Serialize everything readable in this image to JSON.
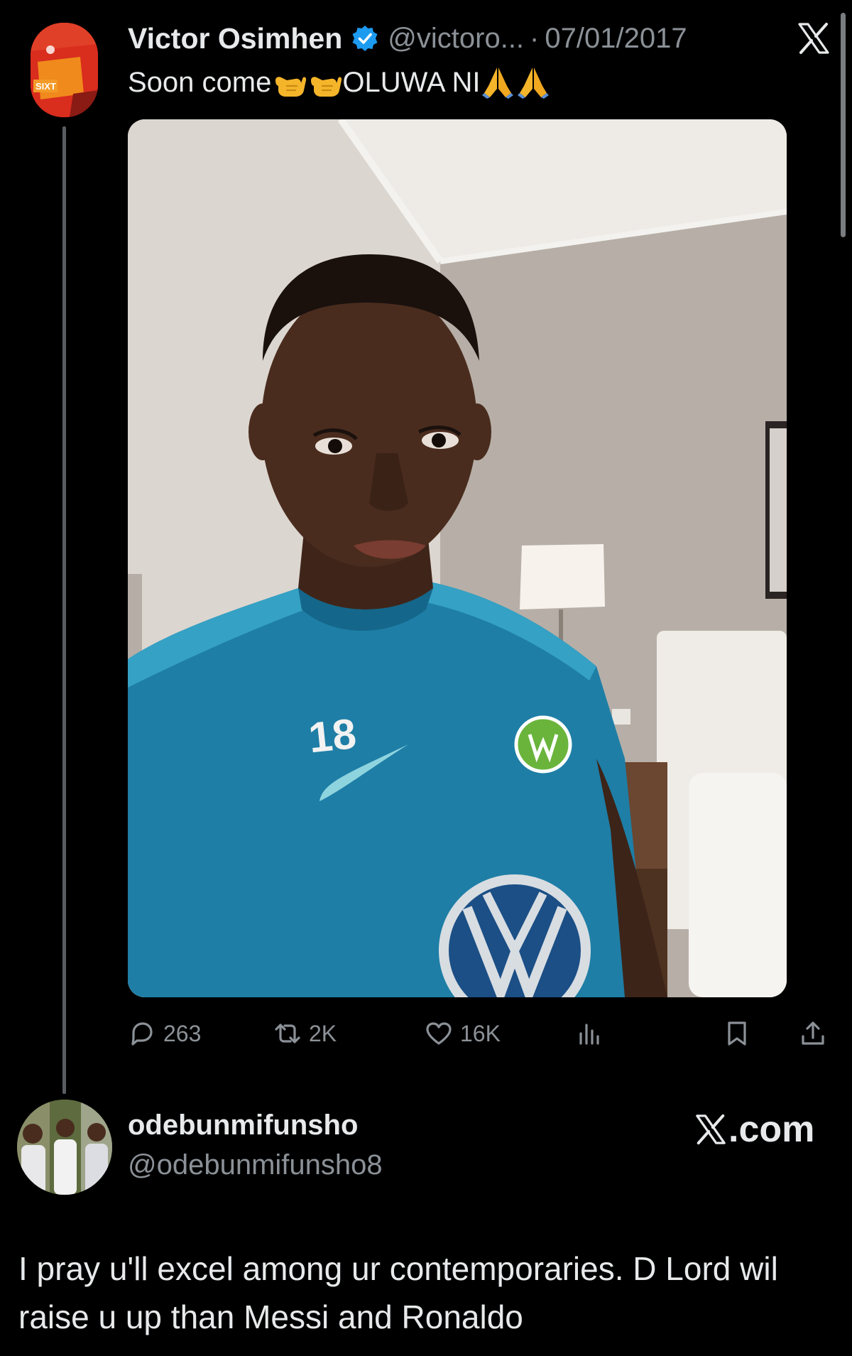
{
  "tweet": {
    "display_name": "Victor Osimhen",
    "handle": "@victoro...",
    "separator": "·",
    "date": "07/01/2017",
    "text_part1": "Soon come",
    "text_part2": "OLUWA NI",
    "photo_jersey_number": "18",
    "avatar_badge_text": "SIXT"
  },
  "actions": {
    "replies": "263",
    "reposts": "2K",
    "likes": "16K"
  },
  "reply": {
    "name": "odebunmifunsho",
    "handle": "@odebunmifunsho8",
    "text": "I pray u'll excel among ur contemporaries. D Lord wil raise u up than Messi and Ronaldo"
  },
  "brand": {
    "watermark": ".com"
  },
  "icons": {
    "verified": "verified-badge-icon",
    "x": "x-logo-icon",
    "call_me": "call-me-hand-emoji",
    "pray": "folded-hands-emoji"
  },
  "colors": {
    "background": "#000000",
    "text": "#e7e9ea",
    "secondary": "#8b9197",
    "verified": "#1d9bf0",
    "jersey": "#1e7ea6"
  }
}
